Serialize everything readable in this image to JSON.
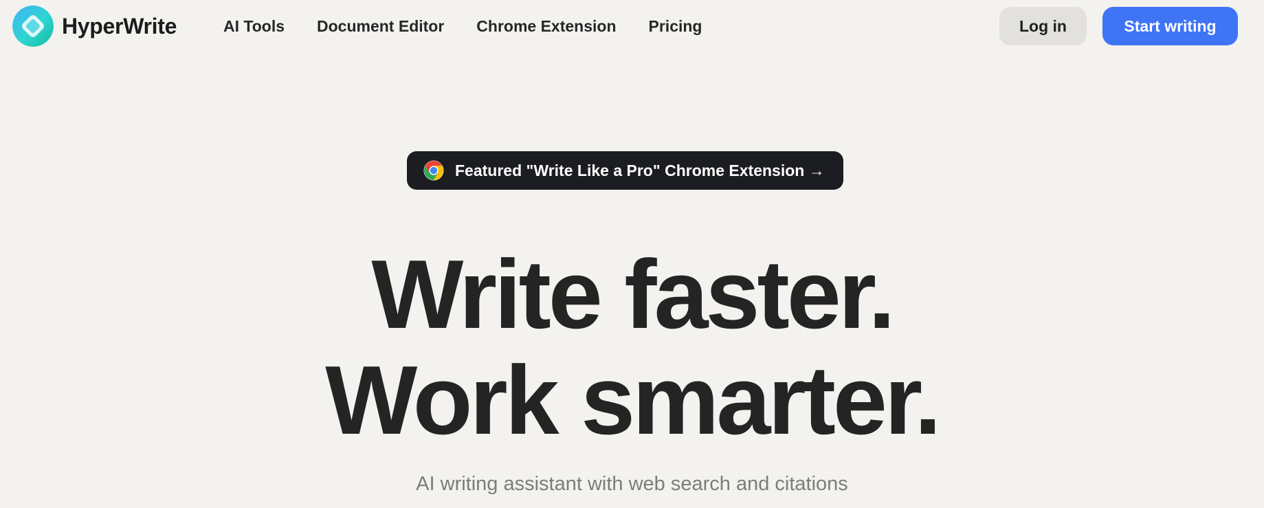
{
  "nav": {
    "brand": "HyperWrite",
    "links": [
      "AI Tools",
      "Document Editor",
      "Chrome Extension",
      "Pricing"
    ],
    "login_label": "Log in",
    "start_label": "Start writing"
  },
  "hero": {
    "badge_text": "Featured \"Write Like a Pro\" Chrome Extension →",
    "headline_line1": "Write faster.",
    "headline_line2": "Work smarter.",
    "subhead": "AI writing assistant with web search and citations"
  },
  "colors": {
    "background": "#f3f2ef",
    "accent": "#3f74f5",
    "badge_bg": "#1b1d21",
    "login_bg": "#e2e1de"
  },
  "icons": {
    "logo": "hyperwrite-logo-icon",
    "badge": "chrome-icon"
  }
}
